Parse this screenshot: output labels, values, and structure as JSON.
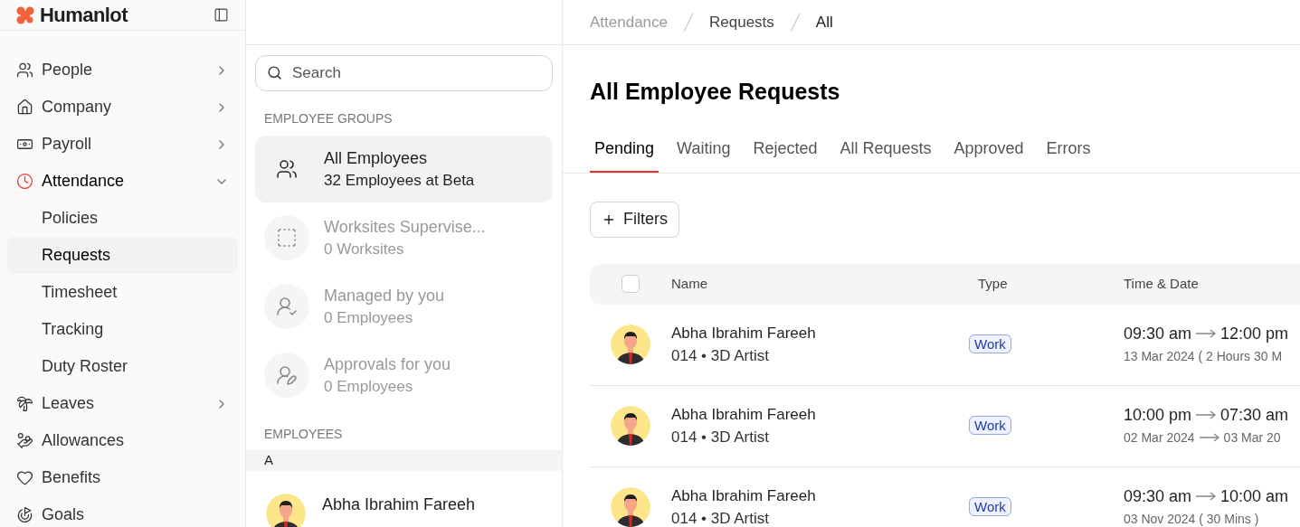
{
  "brand": {
    "name": "Humanlot"
  },
  "sidebar": {
    "items": [
      {
        "label": "People",
        "expanded": false,
        "selected": false
      },
      {
        "label": "Company",
        "expanded": false,
        "selected": false
      },
      {
        "label": "Payroll",
        "expanded": false,
        "selected": false
      },
      {
        "label": "Attendance",
        "expanded": true,
        "selected": true,
        "children": [
          {
            "label": "Policies",
            "selected": false
          },
          {
            "label": "Requests",
            "selected": true
          },
          {
            "label": "Timesheet",
            "selected": false
          },
          {
            "label": "Tracking",
            "selected": false
          },
          {
            "label": "Duty Roster",
            "selected": false
          }
        ]
      },
      {
        "label": "Leaves",
        "expanded": false,
        "selected": false
      },
      {
        "label": "Allowances",
        "selected": false
      },
      {
        "label": "Benefits",
        "selected": false
      },
      {
        "label": "Goals",
        "selected": false
      }
    ]
  },
  "groups_panel": {
    "search": {
      "placeholder": "Search"
    },
    "groups_heading": "EMPLOYEE GROUPS",
    "groups": [
      {
        "title": "All Employees",
        "subtitle": "32 Employees at Beta",
        "selected": true,
        "disabled": false
      },
      {
        "title": "Worksites Supervise...",
        "subtitle": "0 Worksites",
        "selected": false,
        "disabled": true
      },
      {
        "title": "Managed by you",
        "subtitle": "0 Employees",
        "selected": false,
        "disabled": true
      },
      {
        "title": "Approvals for you",
        "subtitle": "0 Employees",
        "selected": false,
        "disabled": true
      }
    ],
    "employees_heading": "EMPLOYEES",
    "letter": "A",
    "employees": [
      {
        "name": "Abha Ibrahim Fareeh"
      }
    ]
  },
  "breadcrumb": [
    "Attendance",
    "Requests",
    "All"
  ],
  "title": "All Employee Requests",
  "tabs": [
    {
      "label": "Pending",
      "selected": true
    },
    {
      "label": "Waiting",
      "selected": false
    },
    {
      "label": "Rejected",
      "selected": false
    },
    {
      "label": "All Requests",
      "selected": false
    },
    {
      "label": "Approved",
      "selected": false
    },
    {
      "label": "Errors",
      "selected": false
    }
  ],
  "filters_button": "Filters",
  "table": {
    "columns": [
      "Name",
      "Type",
      "Time & Date"
    ],
    "select_all_checked": false,
    "rows": [
      {
        "name": "Abha Ibrahim Fareeh",
        "detail": "014 • 3D Artist",
        "type": "Work",
        "time_from": "09:30 am",
        "time_to": "12:00 pm",
        "date": "13 Mar 2024 ( 2 Hours 30 M"
      },
      {
        "name": "Abha Ibrahim Fareeh",
        "detail": "014 • 3D Artist",
        "type": "Work",
        "time_from": "10:00 pm",
        "time_to": "07:30 am",
        "date_from": "02 Mar 2024",
        "date_to": "03 Mar 20"
      },
      {
        "name": "Abha Ibrahim Fareeh",
        "detail": "014 • 3D Artist",
        "type": "Work",
        "time_from": "09:30 am",
        "time_to": "10:00 am",
        "date": "03 Nov 2024 ( 30 Mins )"
      }
    ]
  }
}
